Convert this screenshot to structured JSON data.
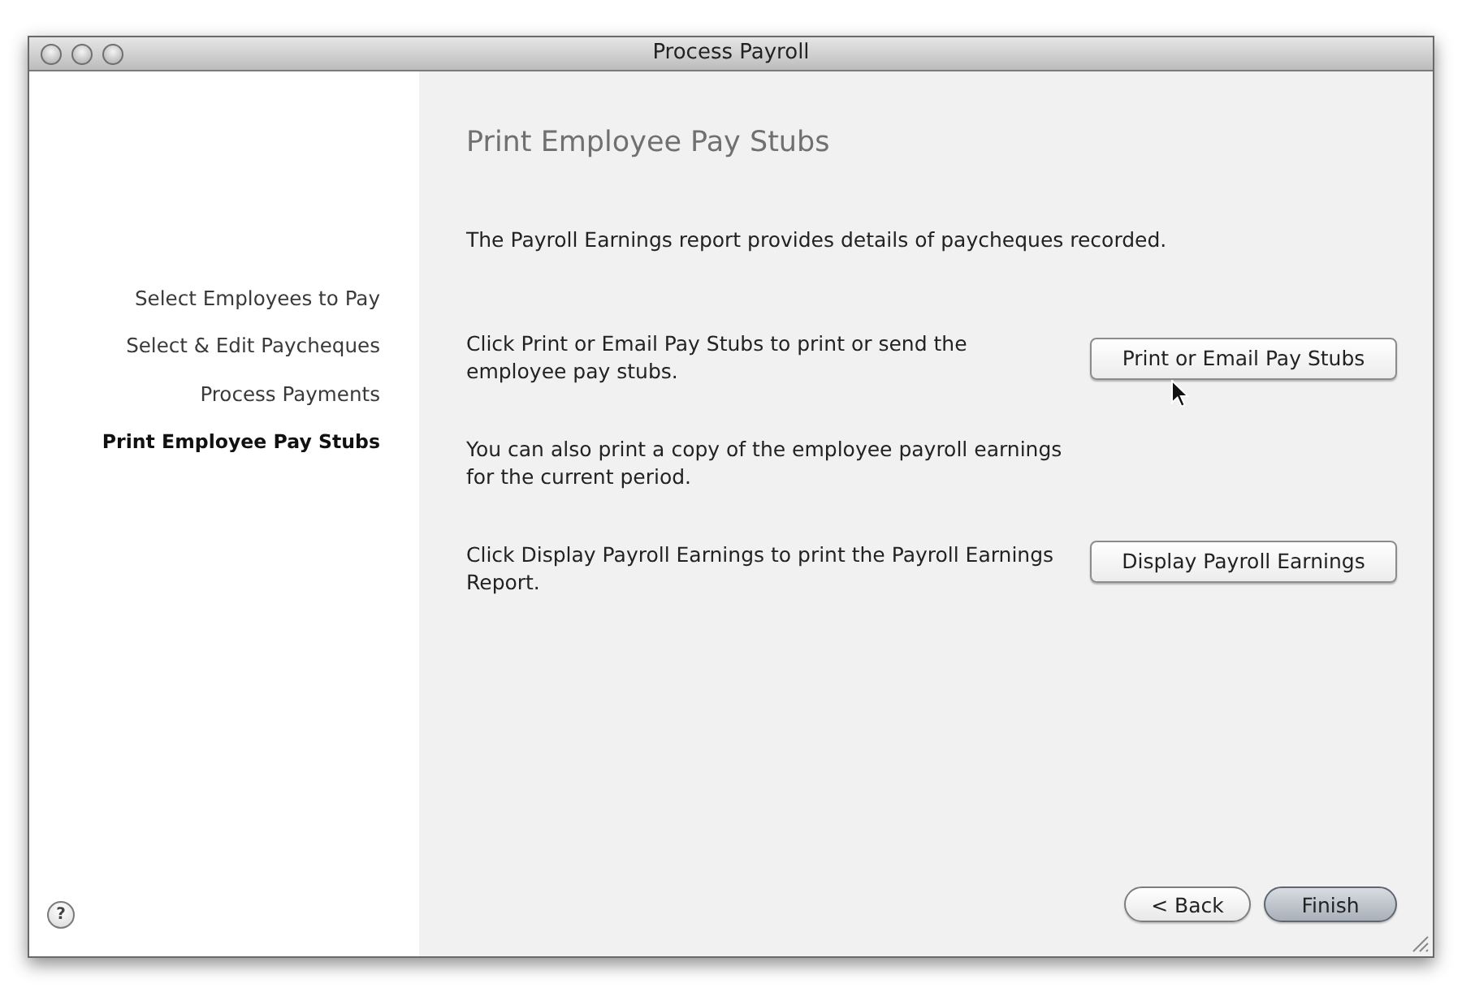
{
  "window": {
    "title": "Process Payroll"
  },
  "sidebar": {
    "items": [
      {
        "label": "Select Employees to Pay",
        "selected": false
      },
      {
        "label": "Select & Edit Paycheques",
        "selected": false
      },
      {
        "label": "Process Payments",
        "selected": false
      },
      {
        "label": "Print Employee Pay Stubs",
        "selected": true
      }
    ]
  },
  "help_button": "?",
  "page": {
    "heading": "Print Employee Pay Stubs",
    "sections": [
      {
        "text": "The Payroll Earnings report provides details of paycheques recorded."
      },
      {
        "text": "Click Print or Email Pay Stubs to print or send the employee pay stubs.",
        "button": "Print or Email Pay Stubs"
      },
      {
        "text": "You can also print a copy of the employee payroll earnings for the current period."
      },
      {
        "text": "Click Display Payroll Earnings to print the Payroll Earnings Report.",
        "button": "Display Payroll Earnings"
      }
    ]
  },
  "footer_buttons": [
    {
      "label": "< Back",
      "default": false
    },
    {
      "label": "Finish",
      "default": true
    }
  ]
}
